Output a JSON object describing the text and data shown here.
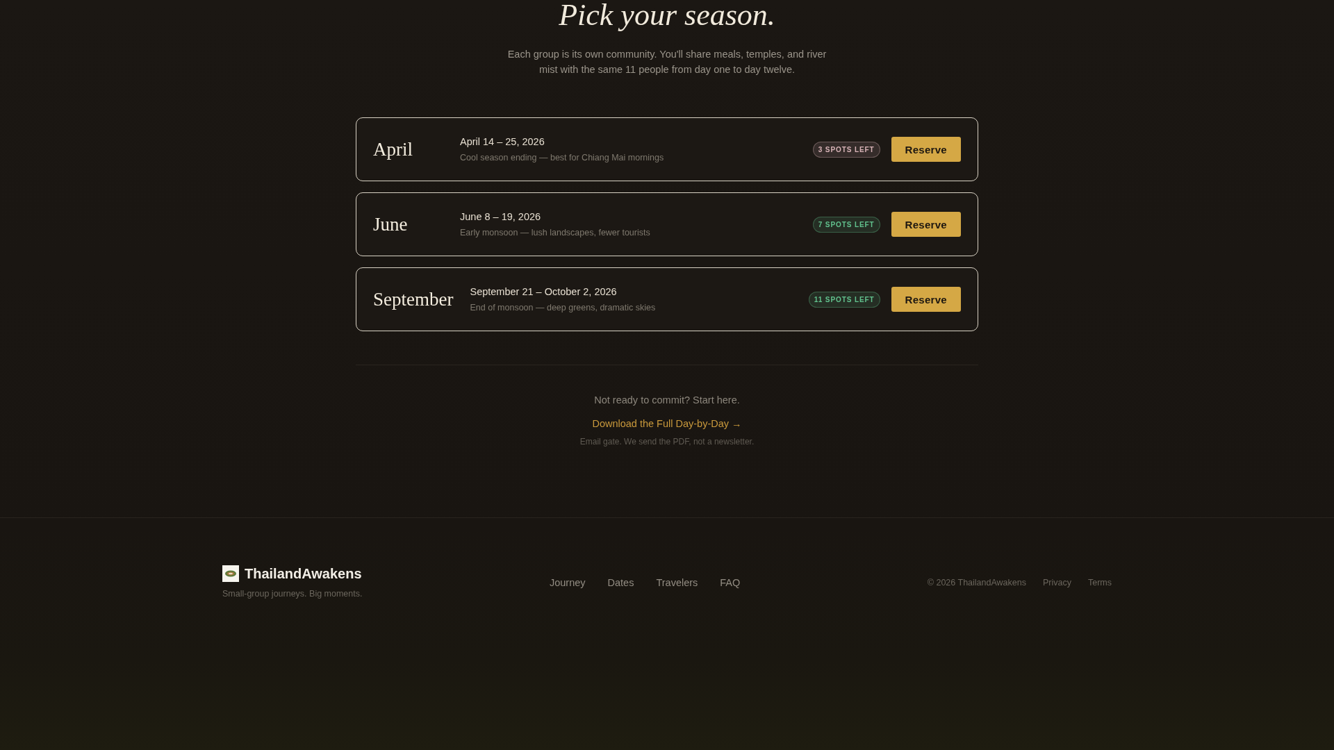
{
  "section": {
    "heading": "Pick your season.",
    "description": "Each group is its own community. You'll share meals, temples, and river mist with the same 11 people from day one to day twelve."
  },
  "dates": [
    {
      "month": "April",
      "range": "April 14 – 25, 2026",
      "note": "Cool season ending — best for Chiang Mai mornings",
      "spots": "3 SPOTS LEFT",
      "color": "#d9b4b8",
      "button": "Reserve"
    },
    {
      "month": "June",
      "range": "June 8 – 19, 2026",
      "note": "Early monsoon — lush landscapes, fewer tourists",
      "spots": "7 SPOTS LEFT",
      "color": "#62c28e",
      "button": "Reserve"
    },
    {
      "month": "September",
      "range": "September 21 – October 2, 2026",
      "note": "End of monsoon — deep greens, dramatic skies",
      "spots": "11 SPOTS LEFT",
      "color": "#62c28e",
      "button": "Reserve"
    }
  ],
  "lead_magnet": {
    "prompt": "Not ready to commit? Start here.",
    "link": "Download the Full Day-by-Day →",
    "note": "Email gate. We send the PDF, not a newsletter."
  },
  "footer": {
    "brand": "ThailandAwakens",
    "tagline": "Small-group journeys. Big moments.",
    "nav": [
      "Journey",
      "Dates",
      "Travelers",
      "FAQ"
    ],
    "copyright": "© 2026 ThailandAwakens",
    "links": [
      "Privacy",
      "Terms"
    ]
  }
}
